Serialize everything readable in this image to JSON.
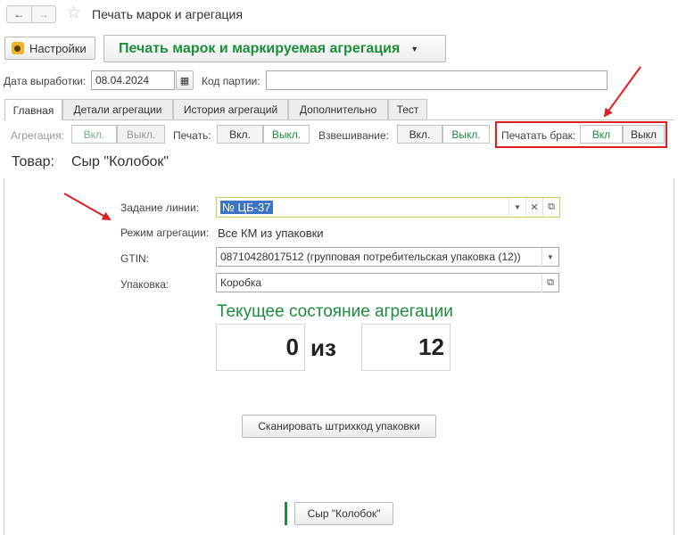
{
  "window": {
    "title": "Печать марок и агрегация",
    "back_icon": "arrow-left-icon",
    "forward_icon": "arrow-right-icon",
    "star_icon": "star-icon"
  },
  "toolbar": {
    "settings_label": "Настройки",
    "main_command_label": "Печать марок и маркируемая агрегация",
    "main_command_color": "#1d8f3a"
  },
  "filters": {
    "date_label": "Дата выработки:",
    "date_value": "08.04.2024",
    "batch_label": "Код партии:",
    "batch_value": ""
  },
  "tabs": [
    {
      "label": "Главная",
      "active": true
    },
    {
      "label": "Детали агрегации",
      "active": false
    },
    {
      "label": "История агрегаций",
      "active": false
    },
    {
      "label": "Дополнительно",
      "active": false
    },
    {
      "label": "Тест",
      "active": false
    }
  ],
  "switches": {
    "aggregation_label": "Агрегация:",
    "aggregation_on": "Вкл.",
    "aggregation_off": "Выкл.",
    "print_label": "Печать:",
    "print_on": "Вкл.",
    "print_off": "Выкл.",
    "weighing_label": "Взвешивание:",
    "weighing_on": "Вкл.",
    "weighing_off": "Выкл.",
    "defect_label": "Печатать брак:",
    "defect_on": "Вкл",
    "defect_off": "Выкл"
  },
  "product": {
    "label": "Товар:",
    "value": "Сыр \"Колобок\""
  },
  "form": {
    "line_task_label": "Задание линии:",
    "line_task_value": "№ ЦБ-37",
    "mode_label": "Режим агрегации:",
    "mode_value": "Все КМ из упаковки",
    "gtin_label": "GTIN:",
    "gtin_value": "08710428017512 (групповая потребительская упаковка (12))",
    "package_label": "Упаковка:",
    "package_value": "Коробка"
  },
  "aggregation_state": {
    "title": "Текущее состояние агрегации",
    "current": "0",
    "separator": "из",
    "total": "12"
  },
  "actions": {
    "scan_label": "Сканировать штрихкод упаковки",
    "product_button_label": "Сыр \"Колобок\""
  },
  "annotations": {
    "highlight_color": "#e02020",
    "arrow_color": "#e02020"
  }
}
